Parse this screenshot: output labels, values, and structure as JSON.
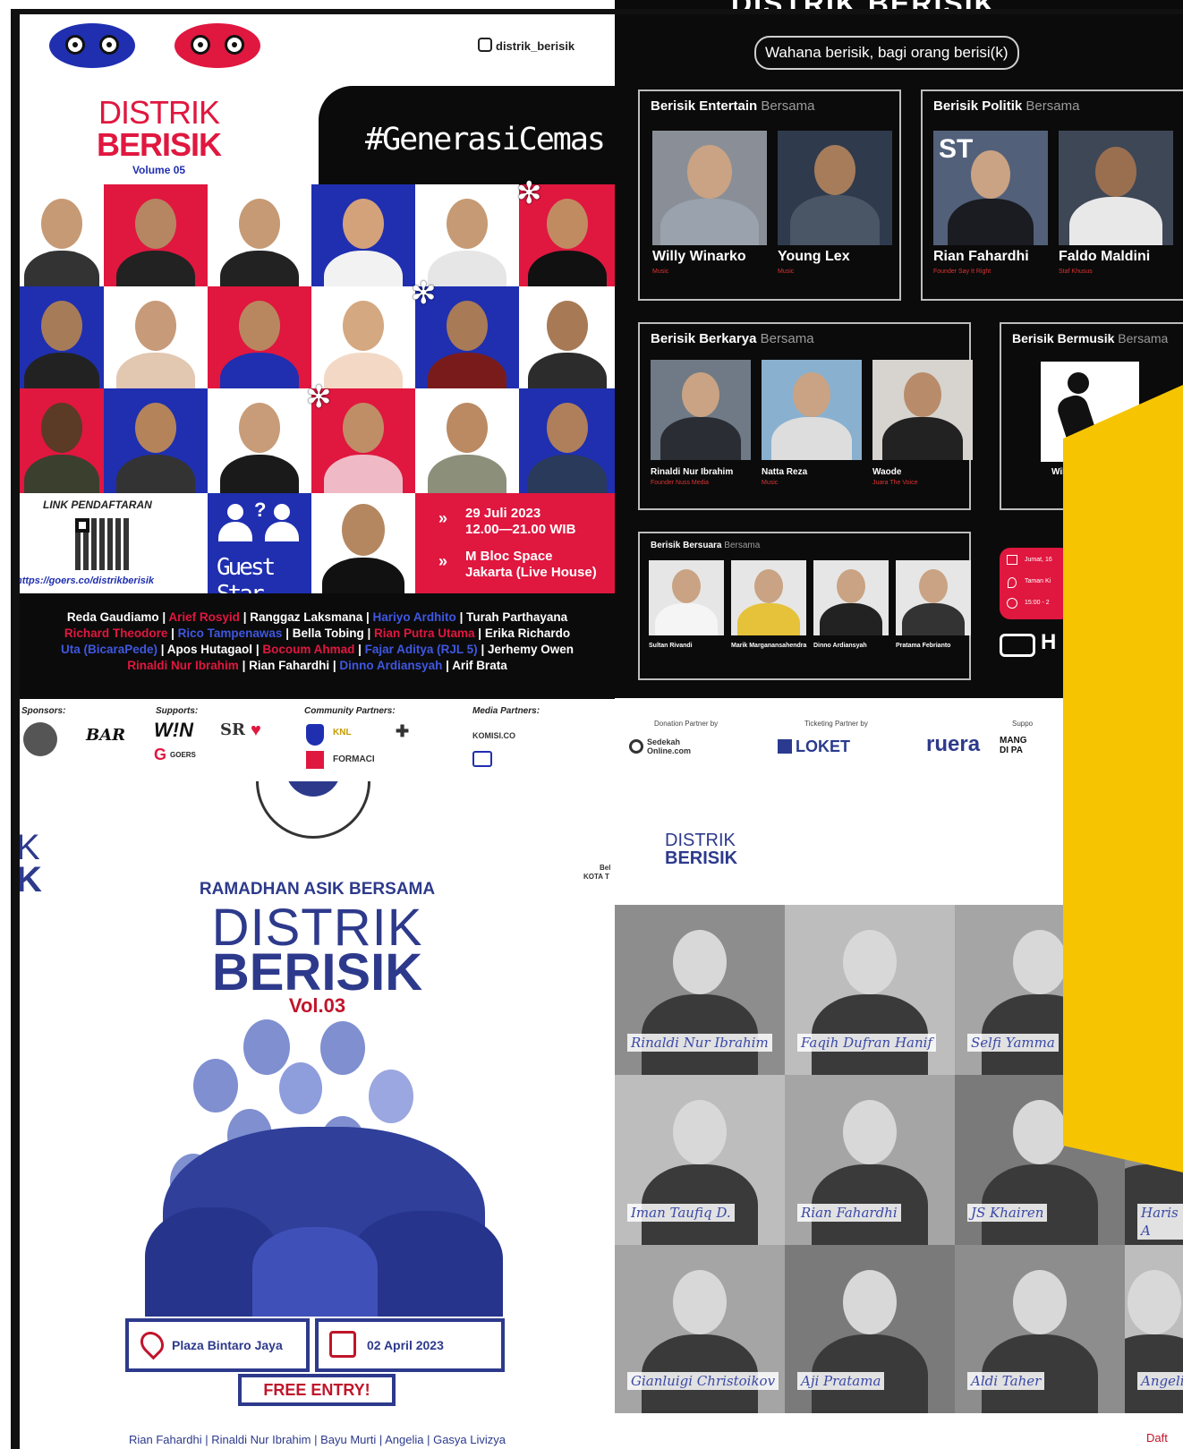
{
  "colors": {
    "blue": "#1f2fb0",
    "red": "#e0173f",
    "black": "#0b0b0b",
    "yellow": "#f6c400",
    "navy_text": "#2d3a8c"
  },
  "tl": {
    "instagram": "distrik_berisik",
    "logo_line1": "DISTRIK",
    "logo_line2": "BERISIK",
    "logo_volume": "Volume 05",
    "hashtag": "#GenerasiCemas",
    "link_label": "LINK PENDAFTARAN",
    "link_url": "https://goers.co/distrikberisik",
    "guest_star": "Guest Star",
    "date": "29 Juli 2023",
    "time": "12.00—21.00 WIB",
    "venue": "M Bloc Space",
    "venue_sub": "Jakarta (Live House)",
    "lineup": [
      [
        {
          "t": "Reda Gaudiamo",
          "c": "w"
        },
        {
          "t": " | ",
          "c": "w"
        },
        {
          "t": "Arief Rosyid",
          "c": "r"
        },
        {
          "t": " | ",
          "c": "w"
        },
        {
          "t": "Ranggaz Laksmana",
          "c": "w"
        },
        {
          "t": " | ",
          "c": "w"
        },
        {
          "t": "Hariyo Ardhito",
          "c": "b"
        },
        {
          "t": " | ",
          "c": "w"
        },
        {
          "t": "Turah Parthayana",
          "c": "w"
        }
      ],
      [
        {
          "t": "Richard Theodore",
          "c": "r"
        },
        {
          "t": " | ",
          "c": "w"
        },
        {
          "t": "Rico Tampenawas",
          "c": "b"
        },
        {
          "t": " | ",
          "c": "w"
        },
        {
          "t": "Bella Tobing",
          "c": "w"
        },
        {
          "t": " | ",
          "c": "w"
        },
        {
          "t": "Rian Putra Utama",
          "c": "r"
        },
        {
          "t": " | ",
          "c": "w"
        },
        {
          "t": "Erika Richardo",
          "c": "w"
        }
      ],
      [
        {
          "t": "Uta (BicaraPede)",
          "c": "b"
        },
        {
          "t": " | ",
          "c": "w"
        },
        {
          "t": "Apos Hutagaol",
          "c": "w"
        },
        {
          "t": " | ",
          "c": "w"
        },
        {
          "t": "Bocoum Ahmad",
          "c": "r"
        },
        {
          "t": " | ",
          "c": "w"
        },
        {
          "t": "Fajar Aditya (RJL 5)",
          "c": "b"
        },
        {
          "t": " | ",
          "c": "w"
        },
        {
          "t": "Jerhemy Owen",
          "c": "w"
        }
      ],
      [
        {
          "t": "Rinaldi Nur Ibrahim",
          "c": "r"
        },
        {
          "t": " | ",
          "c": "w"
        },
        {
          "t": "Rian Fahardhi",
          "c": "w"
        },
        {
          "t": " | ",
          "c": "w"
        },
        {
          "t": "Dinno Ardiansyah",
          "c": "b"
        },
        {
          "t": " | ",
          "c": "w"
        },
        {
          "t": "Arif Brata",
          "c": "w"
        }
      ]
    ],
    "sponsors_label": "Sponsors:",
    "supports_label": "Supports:",
    "community_label": "Community Partners:",
    "media_label": "Media Partners:",
    "logo_win": "W!N",
    "logo_sr": "SR",
    "logo_bar": "BAR",
    "logo_goers": "GOERS",
    "logo_knl": "KNL",
    "logo_formaci": "FORMACI",
    "logo_komisi": "KOMISI.CO"
  },
  "tr": {
    "top_title": "DISTRIK BERISIK",
    "tagline": "Wahana berisik, bagi orang berisi(k)",
    "bersama": "Bersama",
    "card_entertain": "Berisik Entertain",
    "card_politik": "Berisik Politik",
    "card_berkarya": "Berisik Berkarya",
    "card_bermusik": "Berisik Bermusik",
    "card_bersuara": "Berisik Bersuara",
    "entertain_people": [
      {
        "name": "Willy Winarko",
        "role": "Music"
      },
      {
        "name": "Young Lex",
        "role": "Music"
      }
    ],
    "politik_people": [
      {
        "name": "Rian Fahardhi",
        "role": "Founder Say It Right"
      },
      {
        "name": "Faldo Maldini",
        "role": "Staf Khusus"
      }
    ],
    "berkarya_people": [
      {
        "name": "Rinaldi Nur Ibrahim",
        "role": "Founder Nuss Media"
      },
      {
        "name": "Natta Reza",
        "role": "Music"
      },
      {
        "name": "Waode",
        "role": "Juara The Voice"
      }
    ],
    "bermusik_partial": "Wil",
    "bersuara_people": [
      {
        "name": "Sultan Rivandi"
      },
      {
        "name": "Marik Marganansahendra"
      },
      {
        "name": "Dinno Ardiansyah"
      },
      {
        "name": "Pratama Febrianto"
      }
    ],
    "info_day": "Jumat, 16",
    "info_place": "Taman Ki",
    "info_time": "15:00 - 2",
    "ticket_partial": "H",
    "donation_label": "Donation Partner by",
    "ticketing_label": "Ticketing Partner by",
    "support_label": "Suppo",
    "logo_sedekah": "Sedekah Online.com",
    "logo_loket": "LOKET",
    "logo_ruera": "ruera",
    "logo_mangga": "MANG DI PA"
  },
  "bl": {
    "edge_k1": "K",
    "edge_k2": "K",
    "kicker": "RAMADHAN ASIK BERSAMA",
    "title1": "DISTRIK",
    "title2": "BERISIK",
    "vol": "Vol.03",
    "location": "Plaza Bintaro Jaya",
    "date": "02 April 2023",
    "free": "FREE ENTRY!",
    "bottom_line": "Rian Fahardhi | Rinaldi Nur Ibrahim | Bayu Murti | Angelia | Gasya Livizya",
    "edge_small1": "Bel",
    "edge_small2": "KOTA T"
  },
  "br": {
    "logo_line1": "DISTRIK",
    "logo_line2": "BERISIK",
    "grid": [
      {
        "name": "Rinaldi Nur Ibrahim"
      },
      {
        "name": "Faqih Dufran Hanif"
      },
      {
        "name": "Selfi Yamma"
      },
      {
        "name": ""
      },
      {
        "name": "Iman Taufiq D."
      },
      {
        "name": "Rian Fahardhi"
      },
      {
        "name": "JS Khairen"
      },
      {
        "name": "Haris A"
      },
      {
        "name": "Gianluigi Christoikov"
      },
      {
        "name": "Aji Pratama"
      },
      {
        "name": "Aldi Taher"
      },
      {
        "name": "Angelia"
      }
    ],
    "bottom_partial": "Daft"
  }
}
